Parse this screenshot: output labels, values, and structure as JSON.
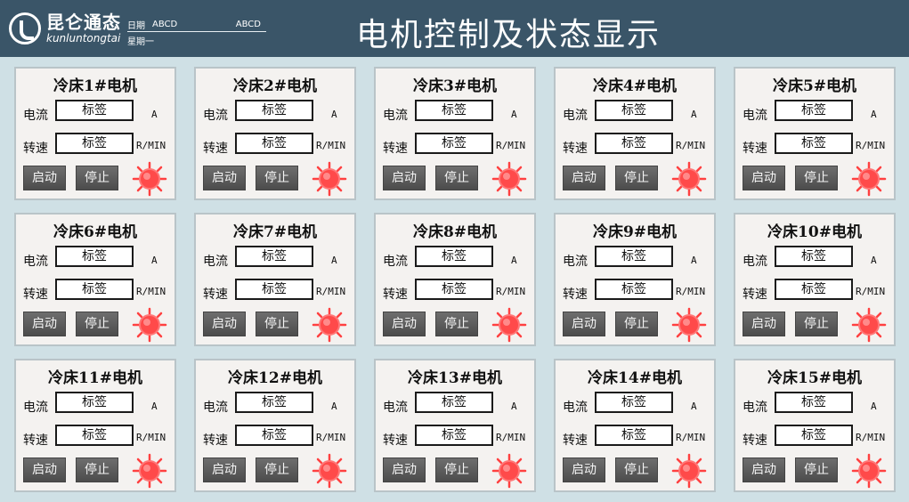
{
  "header": {
    "logo_cn": "昆仑通态",
    "logo_en": "kunluntongtai",
    "date_label": "日期",
    "date_value_1": "ABCD",
    "date_value_2": "ABCD",
    "week_label": "星期一",
    "title": "电机控制及状态显示"
  },
  "colors": {
    "header_bg": "#3a5568",
    "page_bg": "#cfe0e5",
    "lamp_red": "#ff4040"
  },
  "panels": [
    {
      "title": "冷床1#电机"
    },
    {
      "title": "冷床2#电机"
    },
    {
      "title": "冷床3#电机"
    },
    {
      "title": "冷床4#电机"
    },
    {
      "title": "冷床5#电机"
    },
    {
      "title": "冷床6#电机"
    },
    {
      "title": "冷床7#电机"
    },
    {
      "title": "冷床8#电机"
    },
    {
      "title": "冷床9#电机"
    },
    {
      "title": "冷床10#电机"
    },
    {
      "title": "冷床11#电机"
    },
    {
      "title": "冷床12#电机"
    },
    {
      "title": "冷床13#电机"
    },
    {
      "title": "冷床14#电机"
    },
    {
      "title": "冷床15#电机"
    }
  ],
  "panel_common": {
    "current_label": "电流",
    "current_value": "标签",
    "current_unit": "A",
    "speed_label": "转速",
    "speed_value": "标签",
    "speed_unit": "R/MIN",
    "start_label": "启动",
    "stop_label": "停止",
    "lamp_icon": "status-lamp-icon"
  }
}
